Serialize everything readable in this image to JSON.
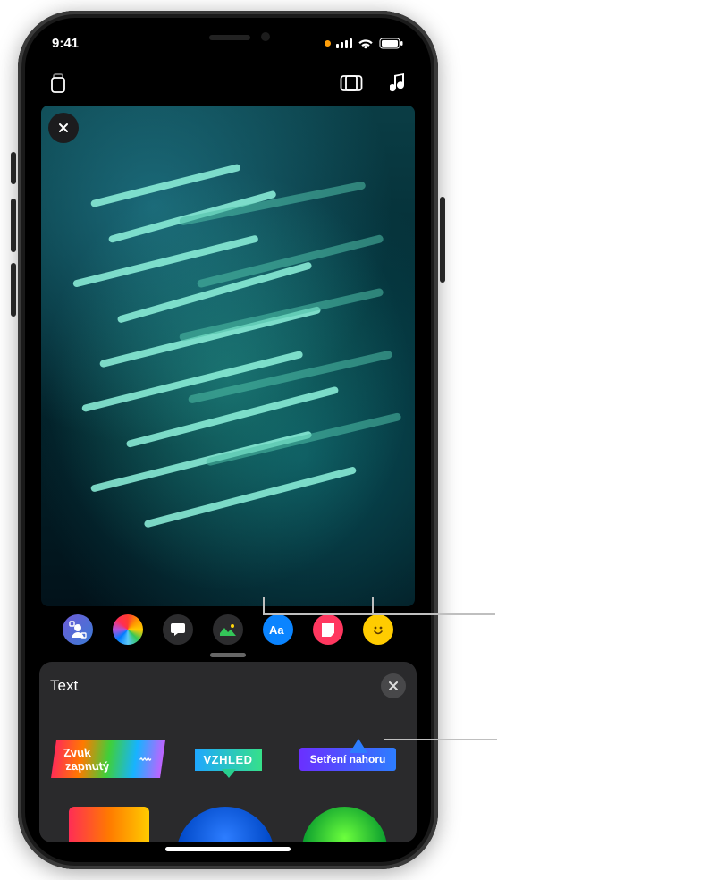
{
  "status": {
    "time": "9:41"
  },
  "panel": {
    "title": "Text",
    "label1": "Zvuk zapnutý",
    "label2": "VZHLED",
    "label3": "Setření nahoru"
  },
  "toolbar": {
    "items": [
      "memoji",
      "filters",
      "text",
      "stickers",
      "aa",
      "shapes",
      "emoji"
    ]
  }
}
